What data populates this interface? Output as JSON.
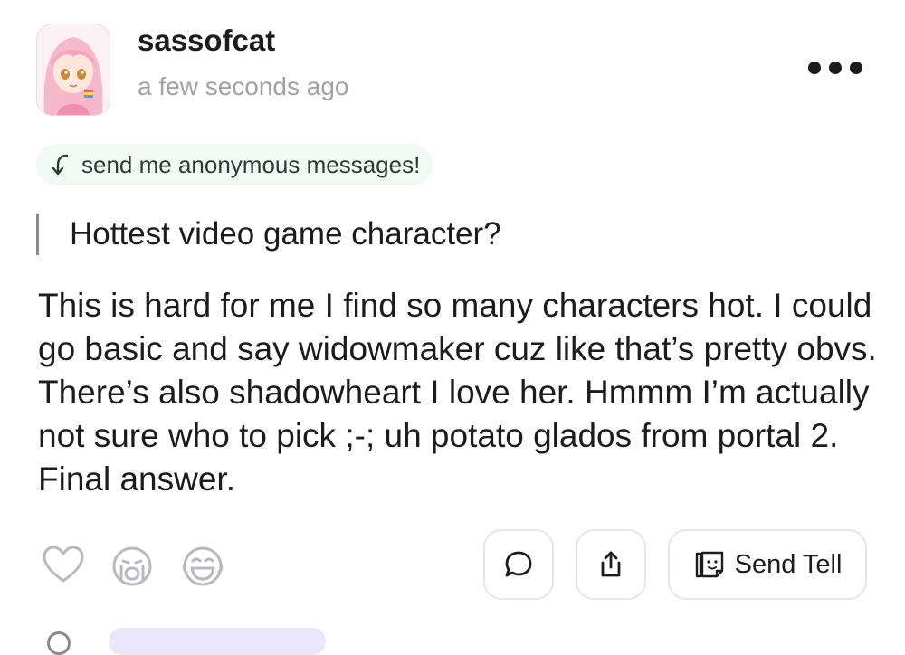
{
  "post": {
    "username": "sassofcat",
    "timestamp": "a few seconds ago",
    "avatar_icon": "anime-girl-avatar",
    "more_icon": "more-dots-icon"
  },
  "anon_prompt": {
    "label": "send me anonymous messages!",
    "icon": "reply-arrow-icon",
    "bg_color": "#eefaf3"
  },
  "question": "Hottest video game character?",
  "answer": "This is hard for me I find so many characters hot. I could go basic and say widowmaker cuz like that’s pretty obvs. There’s also shadowheart I love her. Hmmm I’m actually not sure who to pick ;-; uh potato glados from portal 2. Final answer.",
  "actions": {
    "reactions": [
      "heart-icon",
      "crying-face-icon",
      "laughing-face-icon"
    ],
    "comment_icon": "comment-bubble-icon",
    "share_icon": "share-icon",
    "send_tell_label": "Send Tell",
    "send_tell_icon": "tell-card-icon"
  }
}
